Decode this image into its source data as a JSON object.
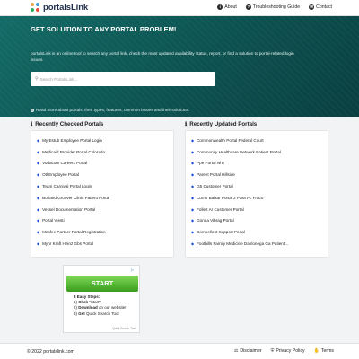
{
  "brand": {
    "name": "portalsLink",
    "logo_dots": [
      "#e8a33c",
      "#3a9ad9",
      "#27ae60",
      "#e74c3c"
    ]
  },
  "nav": [
    {
      "label": "About",
      "icon": "info-icon"
    },
    {
      "label": "Troubleshooting Guide",
      "icon": "help-icon"
    },
    {
      "label": "Contact",
      "icon": "mail-icon"
    }
  ],
  "hero": {
    "title": "GET SOLUTION TO ANY PORTAL PROBLEM!",
    "description": "portalsLink is an online tool to search any portal link, check the most updated availability status, report, or find a solution to portal-related login issues.",
    "search_placeholder": "Search PortalsLink...",
    "read_more": "Read more about portals, their types, features, common issues and their solutions."
  },
  "recently_checked": {
    "heading": "Recently Checked Portals",
    "items": [
      "My Estub Employee Portal Login",
      "Medicaid Provider Portal Colorado",
      "Vodacom Careers Portal",
      "Otl Employee Portal",
      "Team Carnival Portal Login",
      "Borland Groover Clinic Patient Portal",
      "Vessel Documentation Portal",
      "Portal Vjesti",
      "Mcafee Partner Portal Registration",
      "Myhr Kraft Heinz Gbs Portal"
    ]
  },
  "recently_updated": {
    "heading": "Recently Updated Portals",
    "items": [
      "Commonwealth Portal Federal Court",
      "Community Healthcare Network Patient Portal",
      "Ppe Portal Nhs",
      "Parent Portal Hillside",
      "G5 Customer Portal",
      "Como Baixar Portal 2 Para Pc Fraco",
      "Follett Ar Customer Portal",
      "Gonna Vibrag Portal",
      "Compellent Support Portal",
      "Foothills Family Medicine Dahlonega Ga Patient…"
    ]
  },
  "ad": {
    "button": "START",
    "steps_title": "3 Easy Steps:",
    "step1_bold": "Click",
    "step1_rest": " \"Start\"",
    "step2_bold": "Download",
    "step2_rest": " on our website!",
    "step3_bold": "Get",
    "step3_rest": " Quick Search Tool",
    "footer": "Quick Search Tool"
  },
  "footer": {
    "copyright": "© 2022 portalslink.com",
    "links": [
      {
        "label": "Disclaimer",
        "icon": "gavel-icon"
      },
      {
        "label": "Privacy Policy",
        "icon": "shield-icon"
      },
      {
        "label": "Terms",
        "icon": "handshake-icon"
      }
    ]
  },
  "colors": {
    "hero_dark": "#0a3f40",
    "hero_light": "#146b67",
    "bullet": "#1a4fd8",
    "ad_green": "#3a9c1e"
  }
}
